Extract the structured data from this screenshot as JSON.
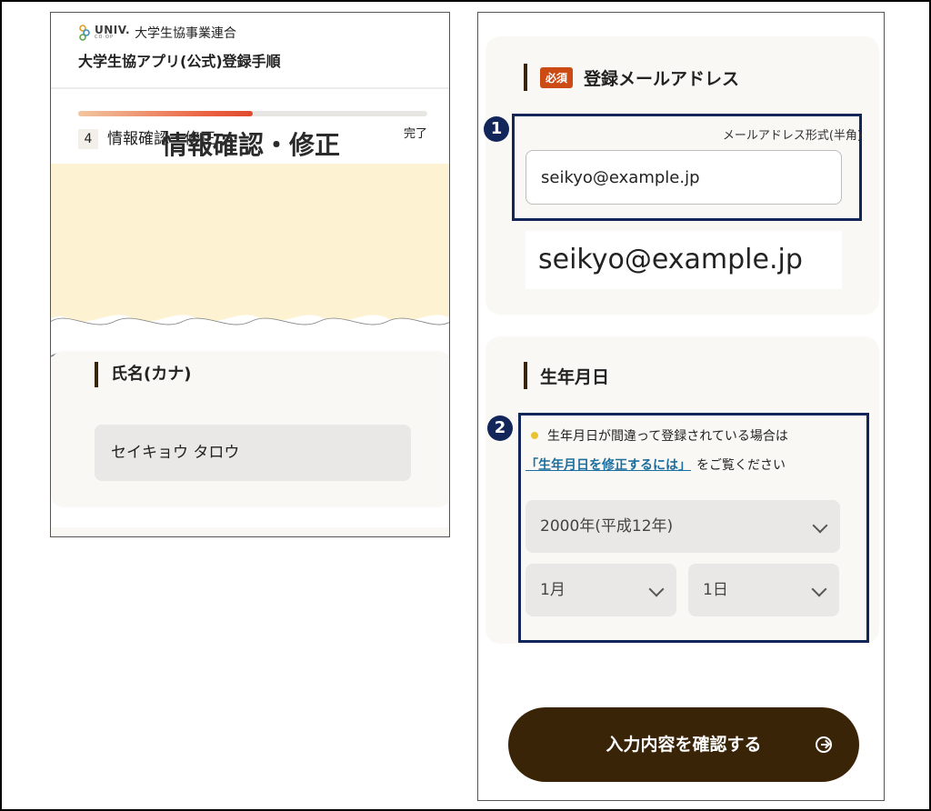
{
  "left": {
    "brand": {
      "univ": "UNIV.",
      "coop": "CO·OP",
      "org": "大学生協事業連合"
    },
    "title": "大学生協アプリ(公式)登録手順",
    "progress": {
      "step_number": "4",
      "step_name": "情報確認・修正",
      "done_label": "完了",
      "fraction": 0.5
    },
    "hero_title": "情報確認・修正",
    "name_section": {
      "label": "氏名(カナ)",
      "value": "セイキョウ タロウ"
    }
  },
  "right": {
    "email_section": {
      "required_badge": "必須",
      "label": "登録メールアドレス",
      "callout_number": "1",
      "hint": "メールアドレス形式(半角)",
      "value": "seikyo@example.jp",
      "zoom_value": "seikyo@example.jp"
    },
    "birth_section": {
      "label": "生年月日",
      "callout_number": "2",
      "warning": "生年月日が間違って登録されている場合は",
      "link_text": "「生年月日を修正するには」",
      "link_suffix": "をご覧ください",
      "year": "2000年(平成12年)",
      "month": "1月",
      "day": "1日"
    },
    "submit_label": "入力内容を確認する"
  },
  "colors": {
    "hero_bg": "#fdf3d3",
    "accent_brown": "#3a2408",
    "required_red": "#cc4a14",
    "callout_navy": "#12265a",
    "link_blue": "#1b6e9e",
    "warn_yellow": "#e8c433"
  },
  "icons": [
    "univ-coop-logo",
    "chevron-down-icon",
    "arrow-circle-right-icon",
    "warning-dot-icon"
  ]
}
